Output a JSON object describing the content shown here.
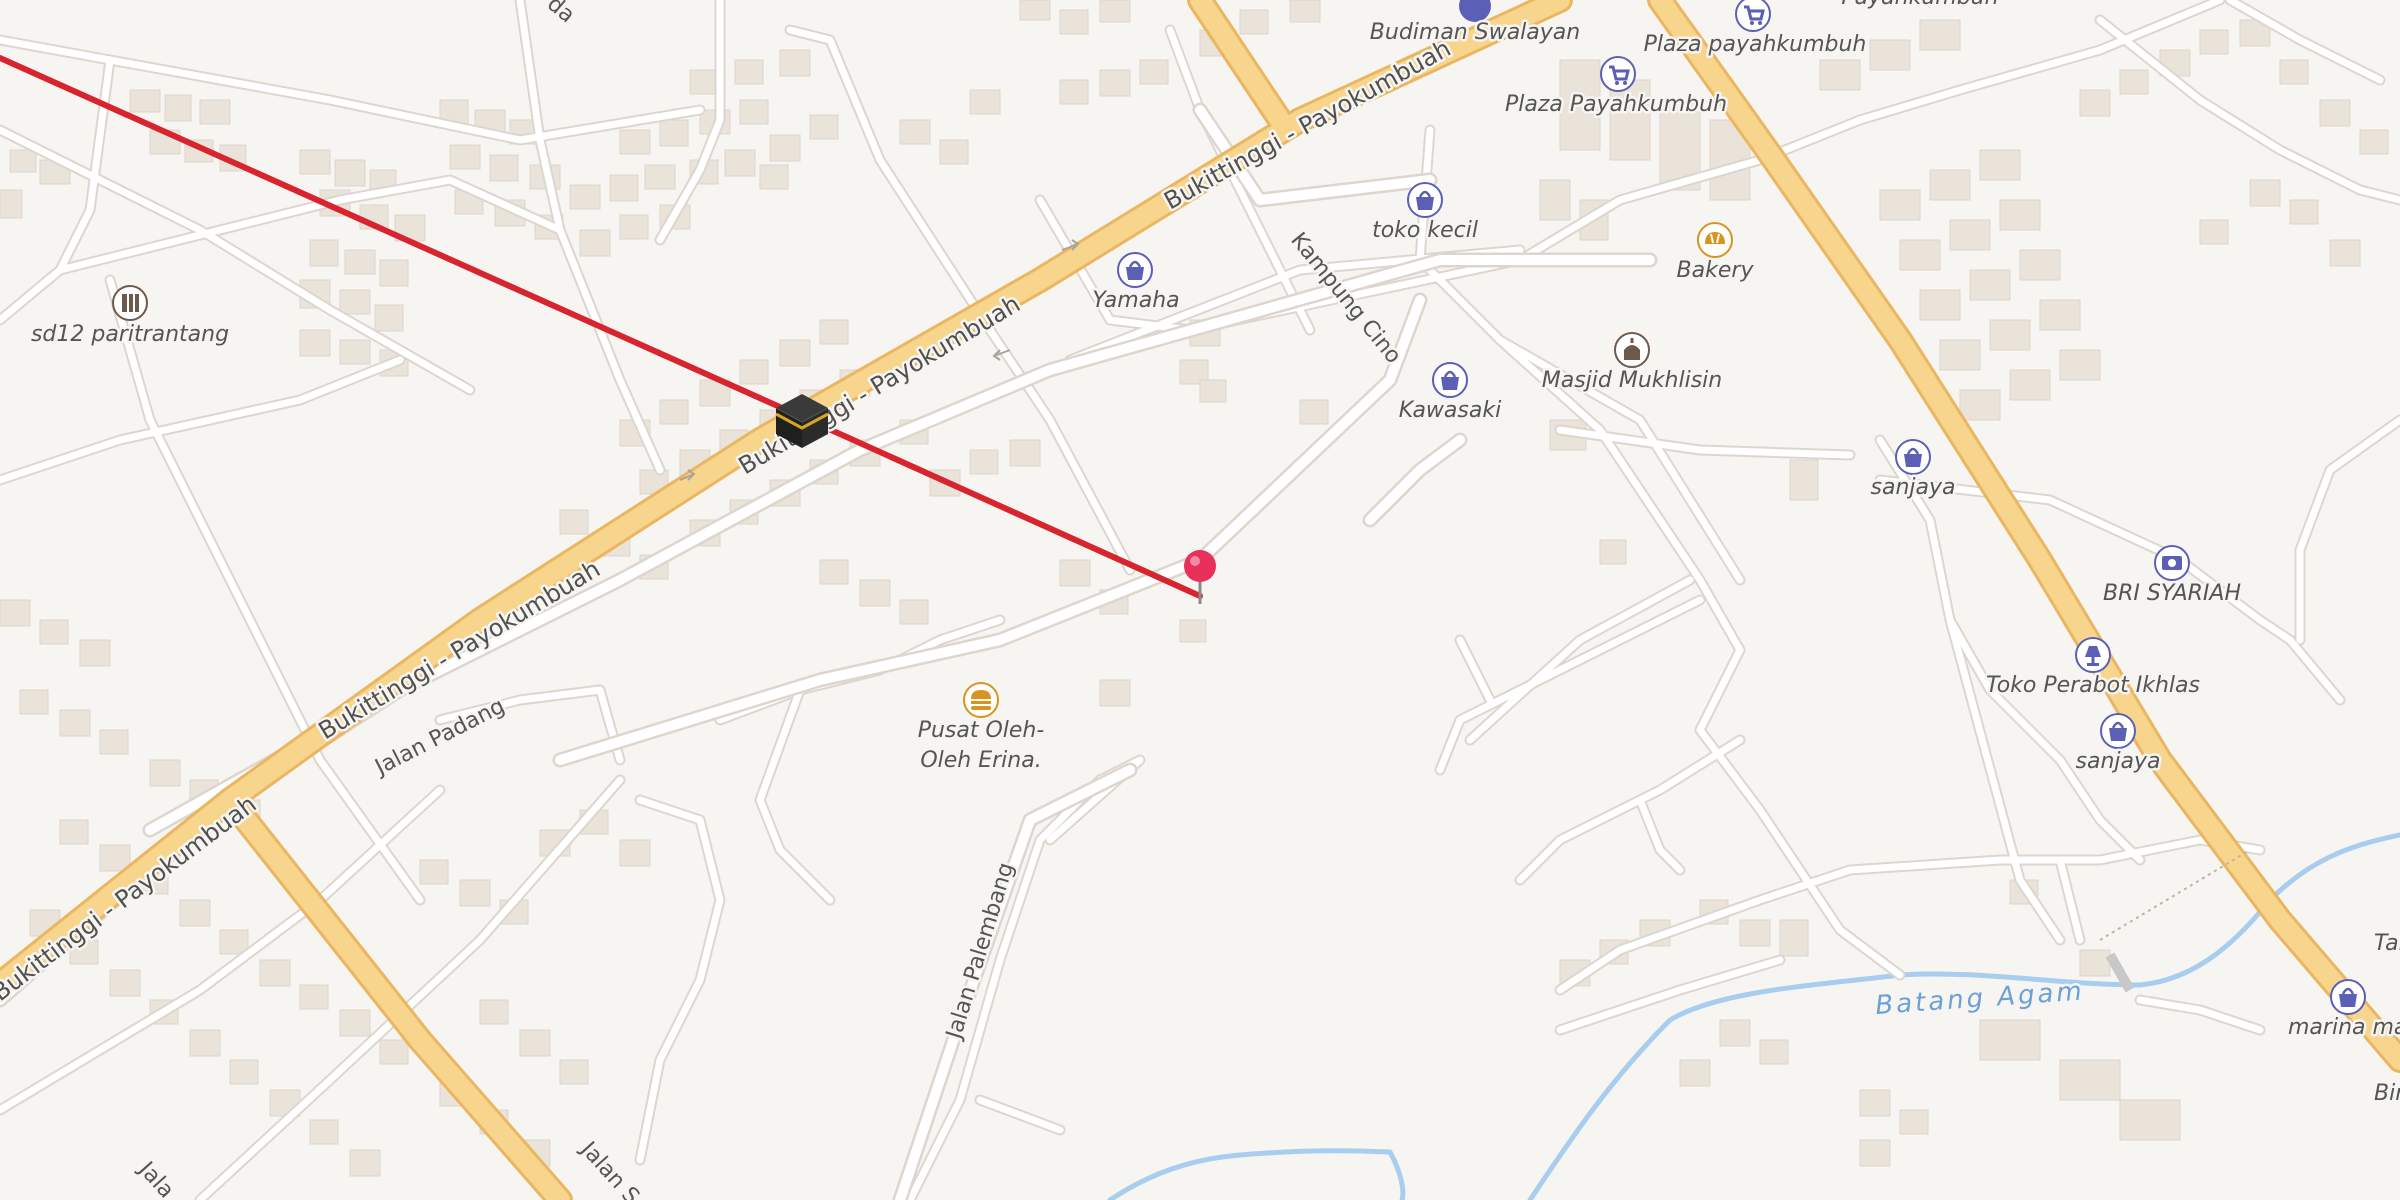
{
  "map": {
    "colors": {
      "background": "#f7f5f2",
      "building": "#e9e3da",
      "road": "#ffffff",
      "road_casing": "#dcd6ce",
      "primary_road": "#f8d58d",
      "primary_casing": "#eab661",
      "water": "#a9cdee",
      "route_line": "#d7242f",
      "pin": "#e8305b",
      "poi_marker": "#5b5fb6",
      "poi_food": "#d9931f"
    },
    "road_labels": {
      "main1": "Bukittinggi - Payokumbuah",
      "main2": "Bukittinggi - Payokumbuah",
      "main3": "Bukittinggi - Payokumbuah",
      "main4": "Bukittinggi - Payokumbuah",
      "jalan_padang": "Jalan Padang",
      "kampung_cino": "Kampung Cino",
      "jalan_palembang": "Jalan Palembang",
      "jalan_s": "Jalan S",
      "jalan_bl": "Jala",
      "top_partial": "da"
    },
    "water_label": "Batang Agam",
    "pois": [
      {
        "label": "Budiman Swalayan",
        "icon": "shopping-cart-icon"
      },
      {
        "label": "Plaza payahkumbuh",
        "icon": "shopping-cart-icon"
      },
      {
        "label": "Plaza Payahkumbuh",
        "icon": "shopping-cart-icon"
      },
      {
        "label": "toko kecil",
        "icon": "shopping-bag-icon"
      },
      {
        "label": "Yamaha",
        "icon": "shopping-bag-icon"
      },
      {
        "label": "Bakery",
        "icon": "bakery-icon"
      },
      {
        "label": "Masjid Mukhlisin",
        "icon": "mosque-icon"
      },
      {
        "label": "Kawasaki",
        "icon": "shopping-bag-icon"
      },
      {
        "label": "sanjaya",
        "icon": "shopping-bag-icon"
      },
      {
        "label": "BRI SYARIAH",
        "icon": "bank-icon"
      },
      {
        "label": "Toko Perabot Ikhlas",
        "icon": "furniture-lamp-icon"
      },
      {
        "label": "sanjaya",
        "icon": "shopping-bag-icon"
      },
      {
        "label": "marina ma",
        "icon": "shopping-bag-icon"
      },
      {
        "label": "Pusat Oleh-",
        "label2": "Oleh Erina.",
        "icon": "fast-food-icon"
      },
      {
        "label": "sd12 paritrantang",
        "icon": "school-icon"
      },
      {
        "label": "Tam",
        "icon": ""
      },
      {
        "label": "Bin",
        "icon": ""
      },
      {
        "label": "Payahkumbuh",
        "icon": ""
      }
    ],
    "markers": {
      "destination": "kaaba-icon",
      "location": "location-pin-icon"
    }
  }
}
